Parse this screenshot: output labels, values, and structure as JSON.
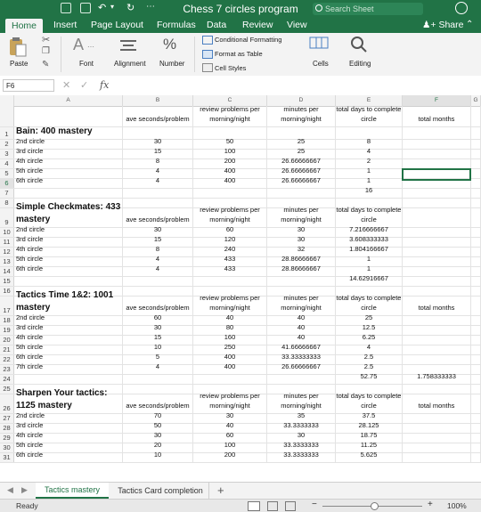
{
  "window": {
    "title": "Chess 7 circles program",
    "search_placeholder": "Search Sheet"
  },
  "tabs": [
    "Home",
    "Insert",
    "Page Layout",
    "Formulas",
    "Data",
    "Review",
    "View"
  ],
  "share_label": "Share",
  "ribbon": {
    "paste": "Paste",
    "font": "Font",
    "alignment": "Alignment",
    "number": "Number",
    "conditional_formatting": "Conditional Formatting",
    "format_as_table": "Format as Table",
    "cell_styles": "Cell Styles",
    "cells": "Cells",
    "editing": "Editing"
  },
  "formula_bar": {
    "name_box": "F6",
    "fx": "fx",
    "value": ""
  },
  "columns": [
    "A",
    "B",
    "C",
    "D",
    "E",
    "F",
    "G"
  ],
  "rows": [
    {
      "n": "",
      "a": "",
      "b": "ave seconds/problem",
      "c": "review problems per morning/night",
      "d": "minutes per morning/night",
      "e": "total days to complete circle",
      "f": "total months"
    },
    {
      "n": "1",
      "a": "Bain: 400 mastery",
      "b": "",
      "c": "",
      "d": "",
      "e": "",
      "f": "",
      "title": true
    },
    {
      "n": "2",
      "a": "2nd circle",
      "b": "30",
      "c": "50",
      "d": "25",
      "e": "8",
      "f": ""
    },
    {
      "n": "3",
      "a": "3rd circle",
      "b": "15",
      "c": "100",
      "d": "25",
      "e": "4",
      "f": ""
    },
    {
      "n": "4",
      "a": "4th circle",
      "b": "8",
      "c": "200",
      "d": "26.66666667",
      "e": "2",
      "f": ""
    },
    {
      "n": "5",
      "a": "5th circle",
      "b": "4",
      "c": "400",
      "d": "26.66666667",
      "e": "1",
      "f": ""
    },
    {
      "n": "6",
      "a": "6th circle",
      "b": "4",
      "c": "400",
      "d": "26.66666667",
      "e": "1",
      "f": ""
    },
    {
      "n": "7",
      "a": "",
      "b": "",
      "c": "",
      "d": "",
      "e": "16",
      "f": ""
    },
    {
      "n": "8",
      "a": "",
      "b": "",
      "c": "",
      "d": "",
      "e": "",
      "f": ""
    },
    {
      "n": "9",
      "a": "Simple Checkmates: 433 mastery",
      "b": "ave seconds/problem",
      "c": "review problems per morning/night",
      "d": "minutes per morning/night",
      "e": "total days to complete circle",
      "f": "",
      "title": true
    },
    {
      "n": "10",
      "a": "2nd circle",
      "b": "30",
      "c": "60",
      "d": "30",
      "e": "7.216666667",
      "f": ""
    },
    {
      "n": "11",
      "a": "3rd circle",
      "b": "15",
      "c": "120",
      "d": "30",
      "e": "3.608333333",
      "f": ""
    },
    {
      "n": "12",
      "a": "4th circle",
      "b": "8",
      "c": "240",
      "d": "32",
      "e": "1.804166667",
      "f": ""
    },
    {
      "n": "13",
      "a": "5th circle",
      "b": "4",
      "c": "433",
      "d": "28.86666667",
      "e": "1",
      "f": ""
    },
    {
      "n": "14",
      "a": "6th circle",
      "b": "4",
      "c": "433",
      "d": "28.86666667",
      "e": "1",
      "f": ""
    },
    {
      "n": "15",
      "a": "",
      "b": "",
      "c": "",
      "d": "",
      "e": "14.62916667",
      "f": ""
    },
    {
      "n": "16",
      "a": "",
      "b": "",
      "c": "",
      "d": "",
      "e": "",
      "f": ""
    },
    {
      "n": "17",
      "a": "Tactics Time 1&2: 1001 mastery",
      "b": "ave seconds/problem",
      "c": "review problems per morning/night",
      "d": "minutes per morning/night",
      "e": "total days to complete circle",
      "f": "total months",
      "title": true
    },
    {
      "n": "18",
      "a": "2nd circle",
      "b": "60",
      "c": "40",
      "d": "40",
      "e": "25",
      "f": ""
    },
    {
      "n": "19",
      "a": "3rd circle",
      "b": "30",
      "c": "80",
      "d": "40",
      "e": "12.5",
      "f": ""
    },
    {
      "n": "20",
      "a": "4th circle",
      "b": "15",
      "c": "160",
      "d": "40",
      "e": "6.25",
      "f": ""
    },
    {
      "n": "21",
      "a": "5th circle",
      "b": "10",
      "c": "250",
      "d": "41.66666667",
      "e": "4",
      "f": ""
    },
    {
      "n": "22",
      "a": "6th circle",
      "b": "5",
      "c": "400",
      "d": "33.33333333",
      "e": "2.5",
      "f": ""
    },
    {
      "n": "23",
      "a": "7th circle",
      "b": "4",
      "c": "400",
      "d": "26.66666667",
      "e": "2.5",
      "f": ""
    },
    {
      "n": "24",
      "a": "",
      "b": "",
      "c": "",
      "d": "",
      "e": "52.75",
      "f": "1.758333333"
    },
    {
      "n": "25",
      "a": "",
      "b": "",
      "c": "",
      "d": "",
      "e": "",
      "f": ""
    },
    {
      "n": "26",
      "a": "Sharpen Your tactics: 1125 mastery",
      "b": "ave seconds/problem",
      "c": "review problems per morning/night",
      "d": "minutes per morning/night",
      "e": "total days to complete circle",
      "f": "total months",
      "title": true
    },
    {
      "n": "27",
      "a": "2nd circle",
      "b": "70",
      "c": "30",
      "d": "35",
      "e": "37.5",
      "f": ""
    },
    {
      "n": "28",
      "a": "3rd circle",
      "b": "50",
      "c": "40",
      "d": "33.3333333",
      "e": "28.125",
      "f": ""
    },
    {
      "n": "29",
      "a": "4th circle",
      "b": "30",
      "c": "60",
      "d": "30",
      "e": "18.75",
      "f": ""
    },
    {
      "n": "30",
      "a": "5th circle",
      "b": "20",
      "c": "100",
      "d": "33.3333333",
      "e": "11.25",
      "f": ""
    },
    {
      "n": "31",
      "a": "6th circle",
      "b": "10",
      "c": "200",
      "d": "33.3333333",
      "e": "5.625",
      "f": ""
    }
  ],
  "sheet_tabs": [
    "Tactics mastery",
    "Tactics Card completion"
  ],
  "add_sheet": "+",
  "status": {
    "text": "Ready",
    "zoom": "100%"
  }
}
